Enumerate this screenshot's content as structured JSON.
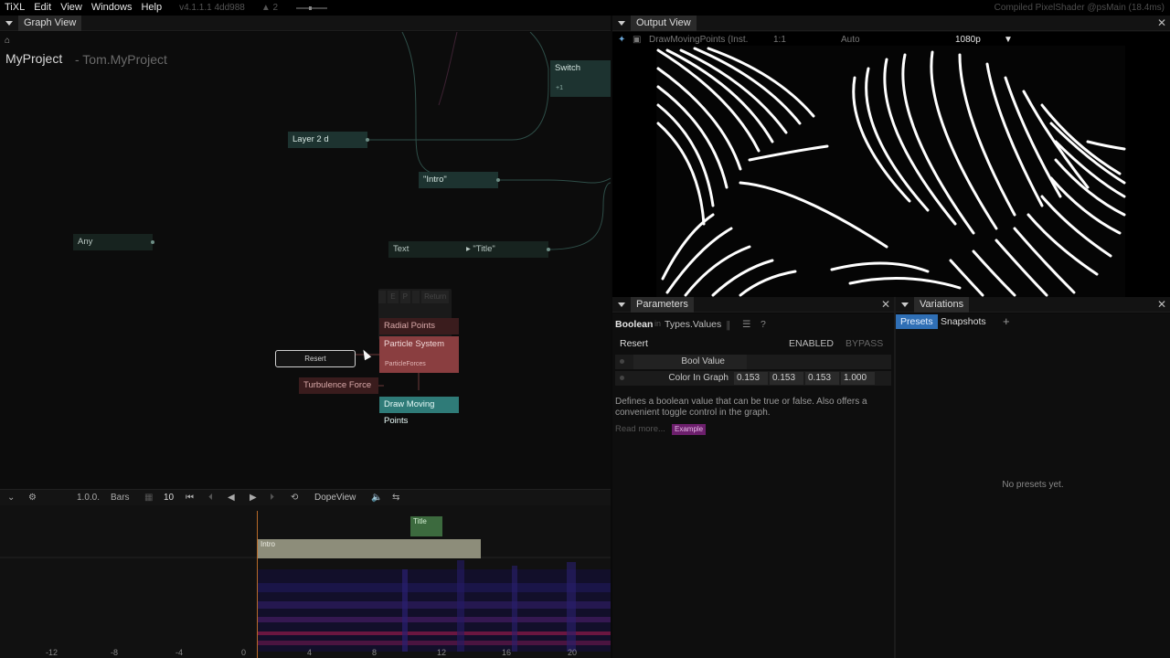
{
  "menubar": {
    "app": "TiXL",
    "items": [
      "Edit",
      "View",
      "Windows",
      "Help"
    ],
    "version": "v4.1.1.1 4dd988",
    "connections": "2",
    "status": "Compiled PixelShader @psMain (18.4ms)"
  },
  "graph_view": {
    "title": "Graph View",
    "project": "MyProject",
    "project_sub": "- Tom.MyProject",
    "nodes": {
      "switch": "Switch",
      "switch_sub": "+1",
      "layer": "Layer 2 d",
      "intro": "\"Intro\"",
      "any": "Any",
      "text": "Text",
      "title": "\"Title\"",
      "radial_points": "Radial Points",
      "particle_system": "Particle System",
      "particle_forces": "ParticleForces",
      "resert": "Resert",
      "turbulence_force": "Turbulence Force",
      "draw_moving_points": "Draw Moving Points"
    },
    "mini_toolbar": [
      "E",
      "P",
      "Return"
    ]
  },
  "timeline": {
    "version": "1.0.0.",
    "mode": "Bars",
    "bpm": "10",
    "view": "DopeView",
    "clips": {
      "intro": "Intro",
      "title": "Title"
    },
    "ruler": [
      "-12",
      "-8",
      "-4",
      "0",
      "4",
      "8",
      "12",
      "16",
      "20"
    ]
  },
  "output_view": {
    "title": "Output View",
    "operator": "DrawMovingPoints (Inst.",
    "zoom": "1:1",
    "camera": "Auto",
    "resolution": "1080p"
  },
  "parameters": {
    "title": "Parameters",
    "op_name": "Boolean",
    "in_word": "in",
    "namespace": "Types.Values",
    "instance": "Resert",
    "enabled": "ENABLED",
    "bypass": "BYPASS",
    "bool_label": "Bool Value",
    "color_label": "Color In Graph",
    "color_values": [
      "0.153",
      "0.153",
      "0.153",
      "1.000"
    ],
    "description": "Defines a boolean value that can be true or false. Also offers a convenient toggle control in the graph.",
    "read_more": "Read more...",
    "example": "Example"
  },
  "variations": {
    "title": "Variations",
    "tabs": [
      "Presets",
      "Snapshots"
    ],
    "add": "+",
    "empty": "No presets yet."
  },
  "colors": {
    "node_teal": "#1d3330",
    "node_red": "#8a3e40",
    "selected_node": "#2f7b78",
    "tab_active": "#2f6fb5",
    "playhead": "#b86a29"
  }
}
